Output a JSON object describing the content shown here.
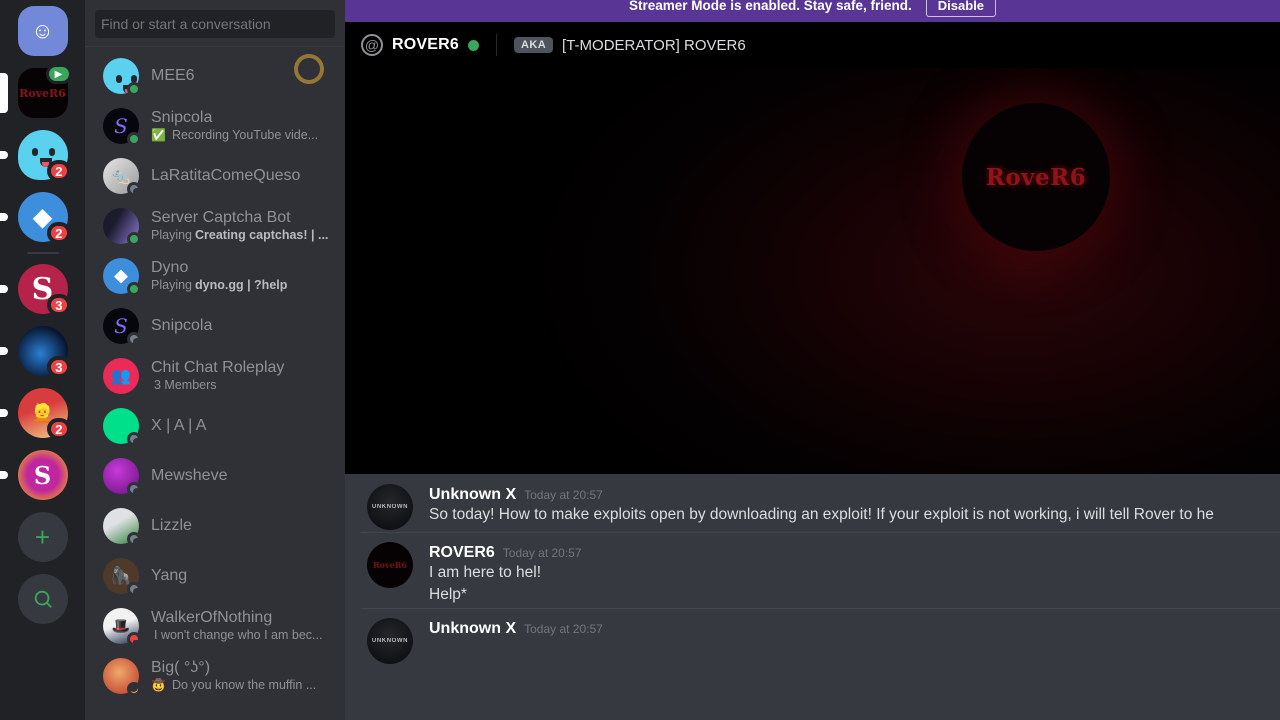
{
  "banner": {
    "text": "Streamer Mode is enabled. Stay safe, friend.",
    "disable_label": "Disable",
    "color": "#593695"
  },
  "search": {
    "placeholder": "Find or start a conversation",
    "value": ""
  },
  "server_rail": {
    "items": [
      {
        "name": "discord-home",
        "label": "",
        "badge": "",
        "indicator": "none",
        "live": false,
        "type": "home"
      },
      {
        "name": "rover6-server",
        "label": "RoveR6",
        "badge": "",
        "indicator": "tall",
        "live": true,
        "type": "image-dark"
      },
      {
        "name": "blob-server",
        "label": "",
        "badge": "2",
        "indicator": "small",
        "live": false,
        "type": "blob"
      },
      {
        "name": "dyno-server",
        "label": "",
        "badge": "2",
        "indicator": "small",
        "live": false,
        "type": "dyno"
      },
      {
        "name": "s-red-server",
        "label": "S",
        "badge": "3",
        "indicator": "small",
        "live": false,
        "type": "letter-red"
      },
      {
        "name": "blue-flame-server",
        "label": "",
        "badge": "3",
        "indicator": "small",
        "live": false,
        "type": "flame"
      },
      {
        "name": "girl-server",
        "label": "",
        "badge": "2",
        "indicator": "small",
        "live": false,
        "type": "girl"
      },
      {
        "name": "s-purple-server",
        "label": "S",
        "badge": "",
        "indicator": "small",
        "live": false,
        "type": "letter-purple"
      }
    ],
    "add_label": "+",
    "explore_label": "search-icon"
  },
  "dm_list": {
    "items": [
      {
        "name": "MEE6",
        "sub": "",
        "sub_bold": "",
        "sub_emoji": "",
        "status": "online",
        "avatar": "blob"
      },
      {
        "name": "Snipcola",
        "sub": "Recording YouTube vide...",
        "sub_bold": "",
        "sub_emoji": "check",
        "status": "online",
        "avatar": "snipcola"
      },
      {
        "name": "LaRatitaComeQueso",
        "sub": "",
        "sub_bold": "",
        "sub_emoji": "",
        "status": "offline",
        "avatar": "ratita"
      },
      {
        "name": "Server Captcha Bot",
        "sub_pre": "Playing ",
        "sub_bold": "Creating captchas! | ...",
        "sub": "",
        "sub_emoji": "",
        "status": "online",
        "avatar": "captcha"
      },
      {
        "name": "Dyno",
        "sub_pre": "Playing ",
        "sub_bold": "dyno.gg | ?help",
        "sub": "",
        "sub_emoji": "",
        "status": "online",
        "avatar": "dyno"
      },
      {
        "name": "Snipcola",
        "sub": "",
        "sub_bold": "",
        "sub_emoji": "",
        "status": "offline",
        "avatar": "snipcola"
      },
      {
        "name": "Chit Chat Roleplay",
        "sub": "3 Members",
        "sub_bold": "",
        "sub_emoji": "",
        "status": "none",
        "avatar": "group"
      },
      {
        "name": "X | A | A",
        "sub": "",
        "sub_bold": "",
        "sub_emoji": "",
        "status": "offline",
        "avatar": "green"
      },
      {
        "name": "Mewsheve",
        "sub": "",
        "sub_bold": "",
        "sub_emoji": "",
        "status": "offline",
        "avatar": "mewsheve"
      },
      {
        "name": "Lizzle",
        "sub": "",
        "sub_bold": "",
        "sub_emoji": "",
        "status": "offline",
        "avatar": "lizzle"
      },
      {
        "name": "Yang",
        "sub": "",
        "sub_bold": "",
        "sub_emoji": "",
        "status": "offline",
        "avatar": "yang"
      },
      {
        "name": "WalkerOfNothing",
        "sub": "I won't change who I am bec...",
        "sub_bold": "",
        "sub_emoji": "",
        "status": "dnd",
        "avatar": "walker"
      },
      {
        "name": "Big( °ʖ°)",
        "sub": "Do you know the muffin ...",
        "sub_bold": "",
        "sub_emoji": "cowboy",
        "status": "idle",
        "avatar": "big"
      }
    ]
  },
  "channel_header": {
    "icon": "at-icon",
    "name": "ROVER6",
    "status": "online",
    "aka_tag": "AKA",
    "aka_name": "[T-MODERATOR] ROVER6"
  },
  "stage": {
    "avatar_text": "RoveR6"
  },
  "messages": [
    {
      "author": "Unknown X",
      "timestamp": "Today at 20:57",
      "avatar": "unknown",
      "lines": [
        "So today! How to make exploits open by downloading an exploit! If your exploit is not working, i will tell Rover to he"
      ]
    },
    {
      "author": "ROVER6",
      "timestamp": "Today at 20:57",
      "avatar": "rover",
      "lines": [
        "I am here to hel!",
        "Help*"
      ]
    },
    {
      "author": "Unknown X",
      "timestamp": "Today at 20:57",
      "avatar": "unknown",
      "lines": [
        ""
      ]
    }
  ],
  "colors": {
    "rail_bg": "#202225",
    "dm_bg": "#2f3136",
    "chat_bg": "#36393f",
    "accent_online": "#3ba55d",
    "accent_danger": "#ed4245",
    "brand_purple": "#593695",
    "cursor_ring": "#9d7a36"
  }
}
